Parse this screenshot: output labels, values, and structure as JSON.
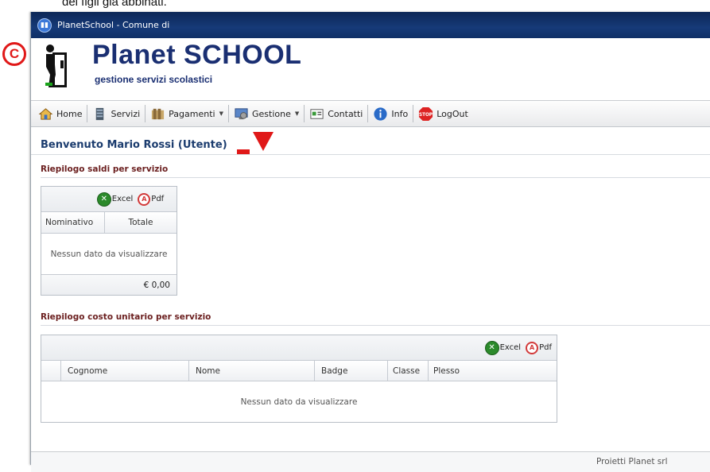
{
  "caption": "dei figli già abbinati.",
  "window": {
    "title": "PlanetSchool - Comune di"
  },
  "logo": {
    "title": "Planet SCHOOL",
    "subtitle": "gestione servizi scolastici"
  },
  "marker": {
    "letter": "C",
    "color": "#e01818"
  },
  "toolbar": {
    "home": "Home",
    "servizi": "Servizi",
    "pagamenti": "Pagamenti",
    "gestione": "Gestione",
    "contatti": "Contatti",
    "info": "Info",
    "logout": "LogOut"
  },
  "welcome": "Benvenuto Mario Rossi (Utente)",
  "saldi": {
    "title": "Riepilogo saldi per servizio",
    "excel": "Excel",
    "pdf": "Pdf",
    "columns": [
      "Nominativo",
      "Totale"
    ],
    "empty": "Nessun dato da visualizzare",
    "total": "€ 0,00"
  },
  "costo": {
    "title": "Riepilogo costo unitario per servizio",
    "excel": "Excel",
    "pdf": "Pdf",
    "columns": [
      "Cognome",
      "Nome",
      "Badge",
      "Classe",
      "Plesso"
    ],
    "empty": "Nessun dato da visualizzare"
  },
  "footer": "Proietti Planet srl",
  "colors": {
    "accent": "#1b3c6e",
    "section": "#6b1f1f",
    "titlebar": "#163a78"
  }
}
